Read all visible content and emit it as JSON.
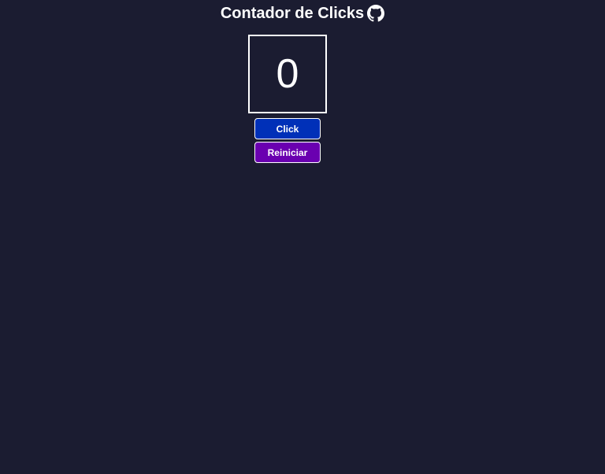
{
  "header": {
    "title": "Contador de Clicks",
    "github_icon": "github-icon"
  },
  "counter": {
    "value": "0"
  },
  "buttons": {
    "click_label": "Click",
    "reset_label": "Reiniciar"
  },
  "colors": {
    "background": "#1b1c31",
    "click_button": "#0030b8",
    "reset_button": "#6a00b0",
    "text": "#ffffff"
  }
}
